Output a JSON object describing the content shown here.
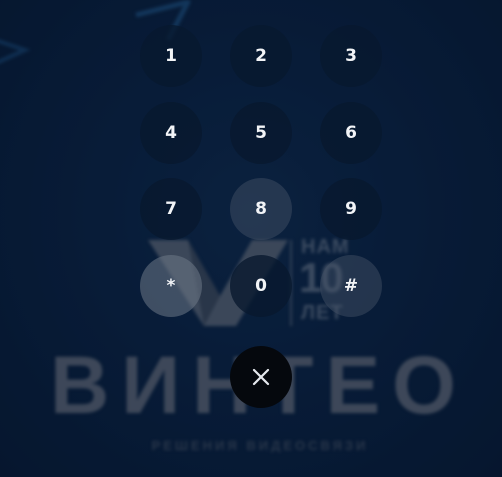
{
  "background": {
    "brand_name": "ВИНТЕО",
    "tagline": "РЕШЕНИЯ ВИДЕОСВЯЗИ",
    "anniversary": {
      "top": "НАМ",
      "number": "10",
      "bottom": "ЛЕТ"
    }
  },
  "keypad": {
    "keys": [
      "1",
      "2",
      "3",
      "4",
      "5",
      "6",
      "7",
      "8",
      "9",
      "*",
      "0",
      "#"
    ],
    "close_icon": "close-icon"
  },
  "colors": {
    "background": "#0a1f3a",
    "key_fill": "#08182e",
    "key_text": "#f2f4f7",
    "close_fill": "#05080d"
  }
}
